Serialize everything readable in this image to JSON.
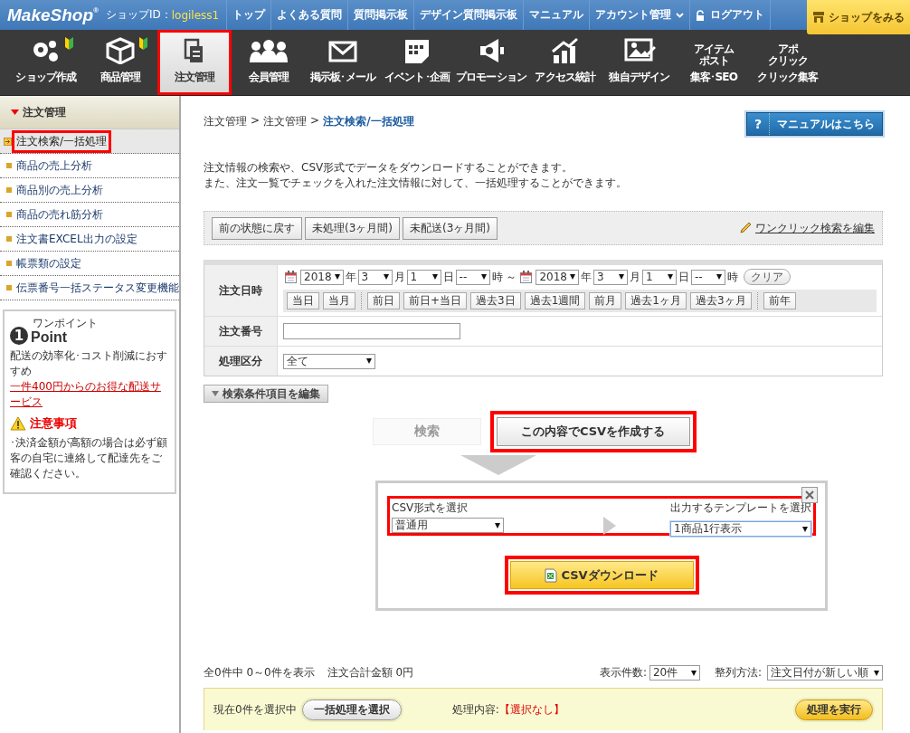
{
  "header": {
    "logo": "MakeShop",
    "logo_mark": "®",
    "shop_id_label": "ショップID：",
    "shop_id": "logiless1",
    "links": [
      {
        "label": "トップ",
        "kind": "link"
      },
      {
        "label": "よくある質問",
        "kind": "link"
      },
      {
        "label": "質問掲示板",
        "kind": "link"
      },
      {
        "label": "デザイン質問掲示板",
        "kind": "link"
      },
      {
        "label": "マニュアル",
        "kind": "link"
      },
      {
        "label": "アカウント管理",
        "kind": "menu"
      },
      {
        "label": "ログアウト",
        "kind": "logout"
      }
    ],
    "view_shop_button": "ショップをみる"
  },
  "nav": [
    {
      "label": "ショップ作成",
      "kind": "icon",
      "beginner": true,
      "selected": false,
      "highlighted": false
    },
    {
      "label": "商品管理",
      "kind": "icon",
      "beginner": true,
      "selected": false,
      "highlighted": false
    },
    {
      "label": "注文管理",
      "kind": "icon",
      "beginner": false,
      "selected": true,
      "highlighted": true
    },
    {
      "label": "会員管理",
      "kind": "icon",
      "beginner": false,
      "selected": false,
      "highlighted": false
    },
    {
      "label": "掲示板･メール",
      "kind": "icon",
      "beginner": false,
      "selected": false,
      "highlighted": false
    },
    {
      "label": "イベント･企画",
      "kind": "icon",
      "beginner": false,
      "selected": false,
      "highlighted": false
    },
    {
      "label": "プロモーション",
      "kind": "icon",
      "beginner": false,
      "selected": false,
      "highlighted": false
    },
    {
      "label": "アクセス統計",
      "kind": "icon",
      "beginner": false,
      "selected": false,
      "highlighted": false
    },
    {
      "label": "独自デザイン",
      "kind": "icon",
      "beginner": false,
      "selected": false,
      "highlighted": false
    },
    {
      "label": "集客･SEO",
      "kind": "wordmark",
      "icon_text": [
        "アイテム",
        "ポスト"
      ],
      "beginner": false,
      "selected": false,
      "highlighted": false
    },
    {
      "label": "クリック集客",
      "kind": "wordmark",
      "icon_text": [
        "アポ",
        "クリック"
      ],
      "beginner": false,
      "selected": false,
      "highlighted": false
    }
  ],
  "sidebar": {
    "title": "注文管理",
    "items": [
      {
        "label": "注文検索/一括処理",
        "selected": true,
        "highlighted": true
      },
      {
        "label": "商品の売上分析",
        "selected": false,
        "highlighted": false
      },
      {
        "label": "商品別の売上分析",
        "selected": false,
        "highlighted": false
      },
      {
        "label": "商品の売れ筋分析",
        "selected": false,
        "highlighted": false
      },
      {
        "label": "注文書EXCEL出力の設定",
        "selected": false,
        "highlighted": false
      },
      {
        "label": "帳票類の設定",
        "selected": false,
        "highlighted": false
      },
      {
        "label": "伝票番号一括ステータス変更機能",
        "selected": false,
        "highlighted": false
      }
    ],
    "point": {
      "number": "1",
      "kana": "ワンポイント",
      "label": "Point",
      "text": "配送の効率化･コスト削減におすすめ",
      "link": "一件400円からのお得な配送サービス"
    },
    "notice": {
      "title": "注意事項",
      "text": "･決済金額が高額の場合は必ず顧客の自宅に連絡して配達先をご確認ください。"
    }
  },
  "breadcrumb": {
    "items": [
      "注文管理",
      "注文管理",
      "注文検索/一括処理"
    ],
    "separator": ">"
  },
  "manual_button": {
    "mark": "?",
    "label": "マニュアルはこちら"
  },
  "description": [
    "注文情報の検索や、CSV形式でデータをダウンロードすることができます。",
    "また、注文一覧でチェックを入れた注文情報に対して、一括処理することができます。"
  ],
  "quick_search": {
    "buttons": [
      "前の状態に戻す",
      "未処理(3ヶ月間)",
      "未配送(3ヶ月間)"
    ],
    "edit_link": "ワンクリック検索を編集"
  },
  "form": {
    "date": {
      "label": "注文日時",
      "parts": [
        {
          "kind": "calendar"
        },
        {
          "kind": "select",
          "value": "2018"
        },
        {
          "kind": "text",
          "text": "年"
        },
        {
          "kind": "select",
          "value": "3"
        },
        {
          "kind": "text",
          "text": "月"
        },
        {
          "kind": "select",
          "value": "1"
        },
        {
          "kind": "text",
          "text": "日"
        },
        {
          "kind": "select",
          "value": "--"
        },
        {
          "kind": "text",
          "text": "時 ～"
        },
        {
          "kind": "calendar"
        },
        {
          "kind": "select",
          "value": "2018"
        },
        {
          "kind": "text",
          "text": "年"
        },
        {
          "kind": "select",
          "value": "3"
        },
        {
          "kind": "text",
          "text": "月"
        },
        {
          "kind": "select",
          "value": "1"
        },
        {
          "kind": "text",
          "text": "日"
        },
        {
          "kind": "select",
          "value": "--"
        },
        {
          "kind": "text",
          "text": "時"
        },
        {
          "kind": "clear",
          "text": "クリア"
        }
      ],
      "preset_groups": [
        [
          "当日",
          "当月"
        ],
        [
          "前日",
          "前日+当日",
          "過去3日",
          "過去1週間",
          "前月",
          "過去1ヶ月",
          "過去3ヶ月"
        ],
        [
          "前年"
        ]
      ]
    },
    "order_number": {
      "label": "注文番号"
    },
    "status": {
      "label": "処理区分",
      "value": "全て"
    }
  },
  "edit_conditions_button": "検索条件項目を編集",
  "search_button": {
    "label": "検索",
    "disabled": true
  },
  "create_csv_button": {
    "label": "この内容でCSVを作成する",
    "highlighted": true
  },
  "csv_panel": {
    "format_label": "CSV形式を選択",
    "format_value": "普通用",
    "template_label": "出力するテンプレートを選択",
    "template_value": "1商品1行表示",
    "selects_highlighted": true,
    "download_button": "CSVダウンロード",
    "download_highlighted": true
  },
  "summary": {
    "count_text": "全0件中 0～0件を表示",
    "total_text": "注文合計金額 0円",
    "per_page_label": "表示件数:",
    "per_page_value": "20件",
    "sort_label": "整列方法:",
    "sort_value": "注文日付が新しい順"
  },
  "bulk": {
    "selected_text": "現在0件を選択中",
    "choose_button": "一括処理を選択",
    "action_label": "処理内容:",
    "action_value": "【選択なし】",
    "run_button": "処理を実行"
  }
}
